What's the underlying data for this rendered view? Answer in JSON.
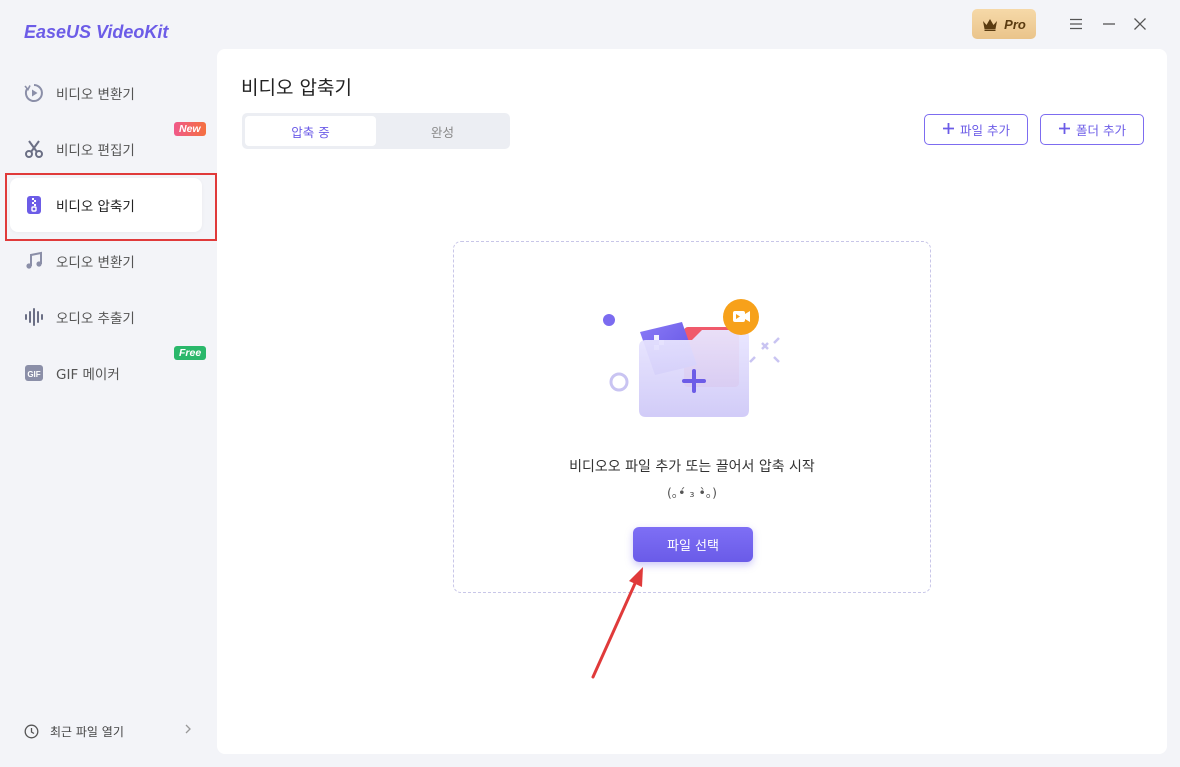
{
  "app": {
    "title": "EaseUS VideoKit"
  },
  "window": {
    "pro_label": "Pro"
  },
  "sidebar": {
    "items": [
      {
        "label": "비디오 변환기",
        "icon": "video-convert-icon"
      },
      {
        "label": "비디오 편집기",
        "icon": "scissors-icon",
        "badge": "New"
      },
      {
        "label": "비디오 압축기",
        "icon": "zip-compress-icon",
        "active": true
      },
      {
        "label": "오디오 변환기",
        "icon": "music-note-icon"
      },
      {
        "label": "오디오 추출기",
        "icon": "audio-wave-icon"
      },
      {
        "label": "GIF 메이커",
        "icon": "gif-icon",
        "badge": "Free"
      }
    ],
    "recent_files_label": "최근 파일 열기"
  },
  "main": {
    "page_title": "비디오 압축기",
    "tabs": [
      {
        "label": "압축 중",
        "active": true
      },
      {
        "label": "완성",
        "active": false
      }
    ],
    "add_file_label": "파일 추가",
    "add_folder_label": "폴더 추가",
    "drop_zone": {
      "message": "비디오오 파일 추가 또는 끌어서 압축 시작",
      "emoticon": "(｡•́ ₃ •̀｡)",
      "select_button_label": "파일 선택"
    }
  },
  "colors": {
    "accent": "#6c5ce7",
    "new_badge": "#f25f6a",
    "free_badge": "#2ab86b",
    "annotation": "#e03a3a",
    "pro_gold": "#eac48b"
  }
}
